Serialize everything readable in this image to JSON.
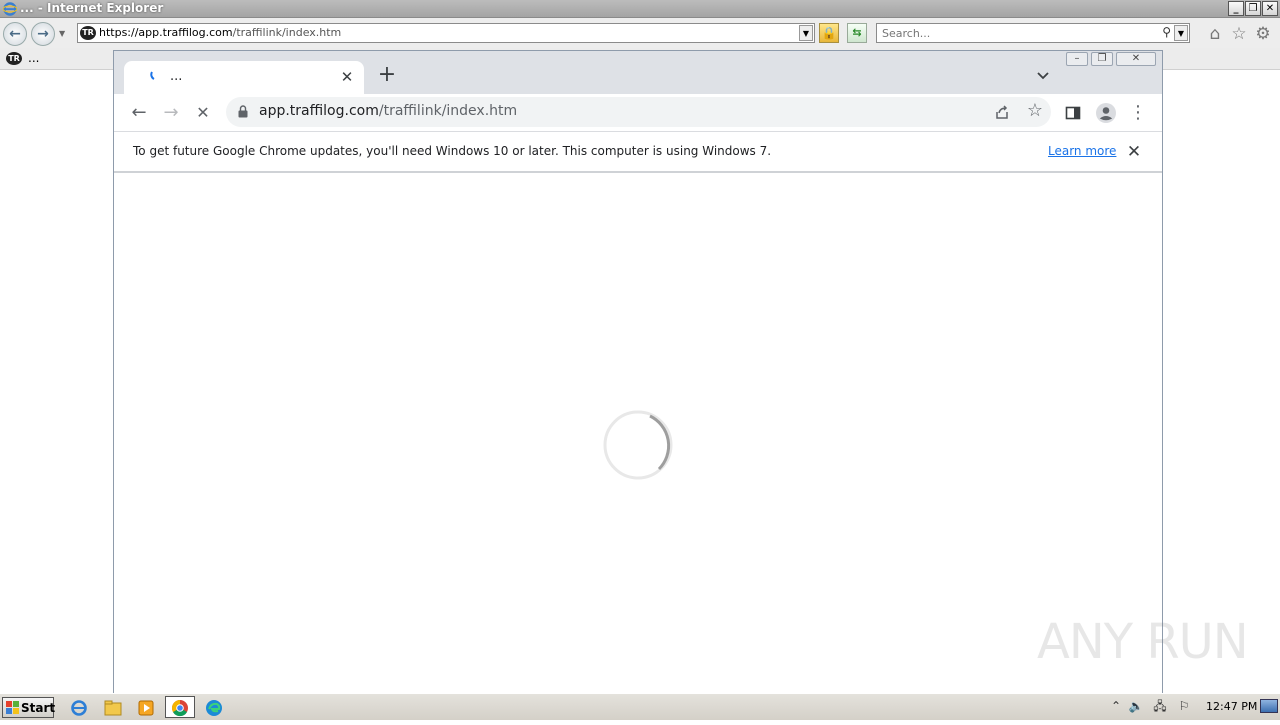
{
  "ie": {
    "title": "... - Internet Explorer",
    "address": {
      "url_host": "https://app.traffilog.com",
      "url_path": "/traffilink/index.htm",
      "favicon_text": "TR"
    },
    "search": {
      "placeholder": "Search..."
    },
    "tab": {
      "label": "..."
    },
    "window_buttons": {
      "minimize": "_",
      "restore": "❐",
      "close": "✕"
    }
  },
  "chrome": {
    "tab": {
      "title": "...",
      "close": "✕"
    },
    "new_tab": "+",
    "tab_menu": "⌄",
    "window_buttons": {
      "minimize": "–",
      "restore": "❐",
      "close": "✕"
    },
    "toolbar": {
      "back": "←",
      "forward": "→",
      "stop": "✕",
      "url_host": "app.traffilog.com",
      "url_path": "/traffilink/index.htm",
      "star": "☆",
      "menu": "⋮"
    },
    "infobar": {
      "message": "To get future Google Chrome updates, you'll need Windows 10 or later. This computer is using Windows 7.",
      "link": "Learn more",
      "close": "✕"
    }
  },
  "watermark": {
    "text": "ANY RUN"
  },
  "taskbar": {
    "start_label": "Start",
    "clock": "12:47 PM"
  },
  "colors": {
    "chrome_tabstrip": "#dee1e6",
    "omnibox": "#f1f3f4",
    "link": "#1a73e8",
    "taskbar": "#d4d0c8"
  }
}
